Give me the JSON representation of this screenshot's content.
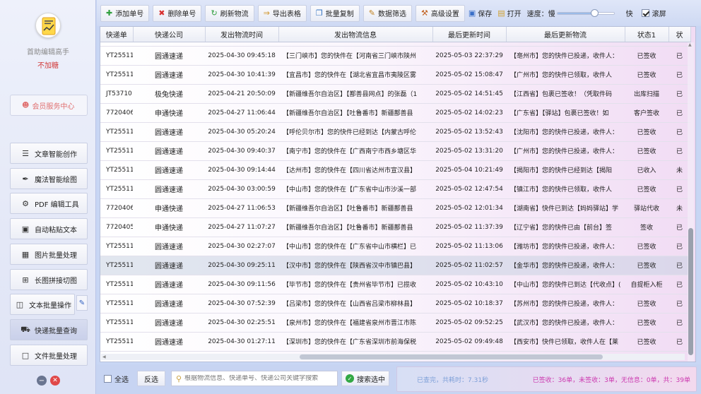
{
  "sidebar": {
    "app_name": "首助编辑高手",
    "app_sub": "不加糖",
    "member_label": "会员服务中心",
    "items": [
      {
        "label": "文章智能创作",
        "icon": "list-icon"
      },
      {
        "label": "魔法智能绘图",
        "icon": "brush-icon"
      },
      {
        "label": "PDF 编辑工具",
        "icon": "pdf-icon"
      },
      {
        "label": "自动粘贴文本",
        "icon": "paste-icon"
      },
      {
        "label": "图片批量处理",
        "icon": "image-icon"
      },
      {
        "label": "长图拼接切图",
        "icon": "crop-icon"
      },
      {
        "label": "文本批量操作",
        "icon": "text-icon"
      },
      {
        "label": "快递批量查询",
        "icon": "truck-icon"
      },
      {
        "label": "文件批量处理",
        "icon": "file-icon"
      }
    ]
  },
  "toolbar": {
    "add": "添加单号",
    "delete": "删除单号",
    "refresh": "刷新物流",
    "export": "导出表格",
    "batch_copy": "批量复制",
    "filter": "数据筛选",
    "advanced": "高级设置",
    "save": "保存",
    "open": "打开",
    "speed_label": "速度：慢",
    "speed_fast": "快",
    "speed_value": 0.65,
    "autoscroll": "滚屏",
    "autoscroll_checked": true
  },
  "table": {
    "headers": [
      "快递单",
      "快递公司",
      "发出物流时间",
      "发出物流信息",
      "最后更新时间",
      "最后更新物流",
      "状态1",
      "状"
    ],
    "rows": [
      [
        "YT25511",
        "圆通速递",
        "2025-04-30 09:45:18",
        "【三门峡市】您的快件在【河南省三门峡市陕州",
        "2025-05-03 22:37:29",
        "【亳州市】您的快件已投递，收件人：",
        "已签收",
        "已"
      ],
      [
        "YT25511",
        "圆通速递",
        "2025-04-30 10:41:39",
        "【宜昌市】您的快件在【湖北省宜昌市夷陵区雾",
        "2025-05-02 15:08:47",
        "【广州市】您的快件已领取，收件人",
        "已签收",
        "已"
      ],
      [
        "JT53710",
        "极兔快递",
        "2025-04-21 20:50:09",
        "【新疆维吾尔自治区】【鄯善县网点】的张磊（1",
        "2025-05-02 14:51:45",
        "【江西省】包裹已签收！（凭取件码",
        "出库扫描",
        "已"
      ],
      [
        "7720406",
        "申通快递",
        "2025-04-27 11:06:44",
        "【新疆维吾尔自治区】【吐鲁番市】新疆鄯善县",
        "2025-05-02 14:02:23",
        "【广东省】【驿站】包裹已签收！如",
        "客户签收",
        "已"
      ],
      [
        "YT25511",
        "圆通速递",
        "2025-04-30 05:20:24",
        "【呼伦贝尔市】您的快件已经到达【内蒙古呼伦",
        "2025-05-02 13:52:43",
        "【沈阳市】您的快件已投递，收件人：",
        "已签收",
        "已"
      ],
      [
        "YT25511",
        "圆通速递",
        "2025-04-30 09:40:37",
        "【南宁市】您的快件在【广西南宁市西乡塘区华",
        "2025-05-02 13:31:20",
        "【广州市】您的快件已投递，收件人：",
        "已签收",
        "已"
      ],
      [
        "YT25511",
        "圆通速递",
        "2025-04-30 09:14:44",
        "【达州市】您的快件在【四川省达州市宣汉县】",
        "2025-05-04 10:21:49",
        "【揭阳市】您的快件已经到达【揭阳",
        "已收入",
        "未"
      ],
      [
        "YT25511",
        "圆通速递",
        "2025-04-30 03:00:59",
        "【中山市】您的快件在【广东省中山市沙溪一部",
        "2025-05-02 12:47:54",
        "【镇江市】您的快件已领取，收件人",
        "已签收",
        "已"
      ],
      [
        "7720406",
        "申通快递",
        "2025-04-27 11:06:53",
        "【新疆维吾尔自治区】【吐鲁番市】新疆鄯善县",
        "2025-05-02 12:01:34",
        "【湖南省】快件已到达【妈妈驿站】学",
        "驿站代收",
        "未"
      ],
      [
        "7720405",
        "申通快递",
        "2025-04-27 11:07:27",
        "【新疆维吾尔自治区】【吐鲁番市】新疆鄯善县",
        "2025-05-02 11:37:39",
        "【辽宁省】您的快件已由【前台】签",
        "签收",
        "已"
      ],
      [
        "YT25511",
        "圆通速递",
        "2025-04-30 02:27:07",
        "【中山市】您的快件在【广东省中山市横栏】已",
        "2025-05-02 11:13:06",
        "【潍坊市】您的快件已投递，收件人：",
        "已签收",
        "已"
      ],
      [
        "YT25511",
        "圆通速递",
        "2025-04-30 09:25:11",
        "【汉中市】您的快件在【陕西省汉中市镇巴县】",
        "2025-05-02 11:02:57",
        "【金华市】您的快件已投递，收件人：",
        "已签收",
        "已"
      ],
      [
        "YT25511",
        "圆通速递",
        "2025-04-30 09:11:56",
        "【毕节市】您的快件在【贵州省毕节市】已揽收",
        "2025-05-02 10:43:10",
        "【中山市】您的快件已到达【代收点】(",
        "自提柜入柜",
        "已"
      ],
      [
        "YT25511",
        "圆通速递",
        "2025-04-30 07:52:39",
        "【吕梁市】您的快件在【山西省吕梁市柳林县】",
        "2025-05-02 10:18:37",
        "【苏州市】您的快件已投递，收件人：",
        "已签收",
        "已"
      ],
      [
        "YT25511",
        "圆通速递",
        "2025-04-30 02:25:51",
        "【泉州市】您的快件在【福建省泉州市晋江市陈",
        "2025-05-02 09:52:25",
        "【武汉市】您的快件已投递，收件人：",
        "已签收",
        "已"
      ],
      [
        "YT25511",
        "圆通速递",
        "2025-04-30 01:27:11",
        "【深圳市】您的快件在【广东省深圳市前海保税",
        "2025-05-02 09:49:48",
        "【西安市】快件已领取，收件人在【莱",
        "已签收",
        "已"
      ]
    ]
  },
  "bottom": {
    "select_all": "全选",
    "invert": "反选",
    "search_placeholder": "根据物流信息、快递单号、快递公司关键字搜索",
    "search_button": "搜索选中",
    "status_done": "已查完，共耗时：7.31秒",
    "status_counts": "已签收：36单，未签收：3单，无信息：0单，共：39单"
  }
}
